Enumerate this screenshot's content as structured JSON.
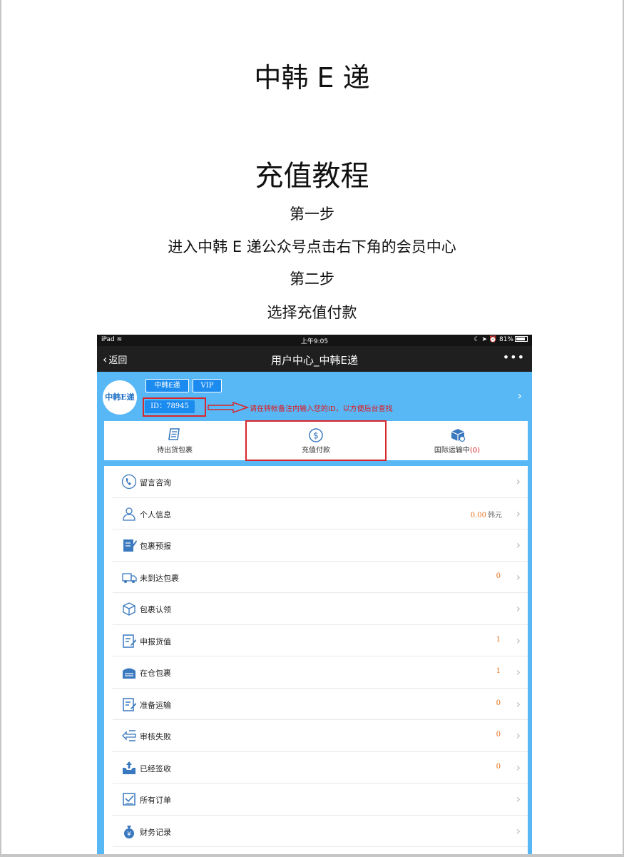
{
  "document": {
    "title": "中韩 E 递",
    "subtitle": "充值教程",
    "lines": [
      "第一步",
      "进入中韩 E 递公众号点击右下角的会员中心",
      "第二步",
      "选择充值付款"
    ]
  },
  "statusbar": {
    "device": "iPad",
    "time": "上午9:05",
    "battery": "81%"
  },
  "navbar": {
    "back_label": "返回",
    "title": "用户中心_中韩E递",
    "more": "•••"
  },
  "profile": {
    "avatar_text": "中韩E递",
    "tags": [
      "中韩E递",
      "VIP"
    ],
    "id_label": "ID：78945",
    "annotation": "请在转帐备注内输入您的ID，以方便后台查找"
  },
  "quick": [
    {
      "label": "待出货包裹",
      "icon": "package-list-icon"
    },
    {
      "label": "充值付款",
      "icon": "dollar-circle-icon"
    },
    {
      "label": "国际运输中",
      "badge": "(0)",
      "icon": "shipping-box-icon"
    }
  ],
  "menu": [
    {
      "label": "留言咨询",
      "value": "",
      "unit": "",
      "icon": "phone-icon"
    },
    {
      "label": "个人信息",
      "value": "0.00",
      "unit": "韩元",
      "icon": "user-icon"
    },
    {
      "label": "包裹预报",
      "value": "",
      "unit": "",
      "icon": "edit-form-icon"
    },
    {
      "label": "未到达包裹",
      "value": "0",
      "unit": "",
      "icon": "truck-icon"
    },
    {
      "label": "包裹认领",
      "value": "",
      "unit": "",
      "icon": "box-icon"
    },
    {
      "label": "申报货值",
      "value": "1",
      "unit": "",
      "icon": "declare-doc-icon"
    },
    {
      "label": "在仓包裹",
      "value": "1",
      "unit": "",
      "icon": "warehouse-icon"
    },
    {
      "label": "准备运输",
      "value": "0",
      "unit": "",
      "icon": "prepare-doc-icon"
    },
    {
      "label": "审核失败",
      "value": "0",
      "unit": "",
      "icon": "fail-arrows-icon"
    },
    {
      "label": "已经签收",
      "value": "0",
      "unit": "",
      "icon": "inbox-upload-icon"
    },
    {
      "label": "所有订单",
      "value": "",
      "unit": "",
      "icon": "order-check-icon"
    },
    {
      "label": "财务记录",
      "value": "",
      "unit": "",
      "icon": "money-bag-icon"
    }
  ],
  "colors": {
    "accent": "#58b7f5",
    "tag_blue": "#1b8bef",
    "annotation_red": "#d8262a",
    "value_orange": "#e8701c"
  }
}
